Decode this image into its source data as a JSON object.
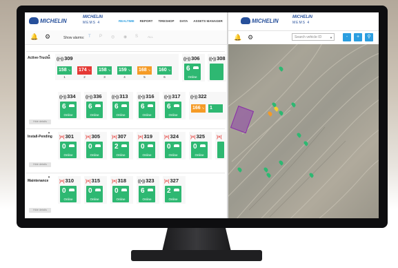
{
  "left_panel": {
    "brand_logo": "MICHELIN",
    "product_logo": {
      "line1": "MICHELIN",
      "line2": "MEMS 4"
    },
    "nav": [
      "REALTIME",
      "REPORT",
      "TIRESHOP",
      "DATA",
      "ASSETS MANAGER"
    ],
    "active_nav": "REALTIME",
    "toolbar": {
      "show_alarms_label": "Show alarms:",
      "all_label": "ALL",
      "icons": [
        "bell-icon",
        "gear-icon",
        "temperature-icon",
        "pressure-icon",
        "tire-icon",
        "signal-icon",
        "s-icon"
      ]
    },
    "sections": [
      {
        "label": "Active-Trucks",
        "hide_label": "Hide details",
        "trucks": [
          {
            "id": "309",
            "mini": [
              {
                "value": "158",
                "unit": "°c",
                "pos": "1"
              },
              {
                "value": "174",
                "unit": "°c",
                "pos": "2"
              },
              {
                "value": "158",
                "unit": "°c",
                "pos": "3"
              },
              {
                "value": "159",
                "unit": "°c",
                "pos": "4"
              },
              {
                "value": "168",
                "unit": "°c",
                "pos": "5"
              },
              {
                "value": "160",
                "unit": "°c",
                "pos": "6"
              }
            ]
          },
          {
            "id": "306",
            "count": "6",
            "status": "Online"
          },
          {
            "id": "308"
          },
          {
            "id": "334",
            "count": "6",
            "status": "Online"
          },
          {
            "id": "336",
            "count": "6",
            "status": "Online"
          },
          {
            "id": "313",
            "count": "6",
            "status": "Online"
          },
          {
            "id": "316",
            "count": "6",
            "status": "Online"
          },
          {
            "id": "317",
            "count": "6",
            "status": "Online"
          },
          {
            "id": "322",
            "mini": [
              {
                "value": "166",
                "unit": "°c"
              },
              {
                "value": "1",
                "unit": ""
              }
            ]
          }
        ]
      },
      {
        "label": "Install-Pending",
        "hide_label": "Hide details",
        "trucks": [
          {
            "id": "301",
            "count": "0",
            "status": "Online"
          },
          {
            "id": "305",
            "count": "0",
            "status": "Online"
          },
          {
            "id": "307",
            "count": "2",
            "status": "Online"
          },
          {
            "id": "319",
            "count": "0",
            "status": "Online"
          },
          {
            "id": "324",
            "count": "0",
            "status": "Online"
          },
          {
            "id": "325",
            "count": "0",
            "status": "Online"
          }
        ]
      },
      {
        "label": "Maintenance",
        "hide_label": "Hide details",
        "trucks": [
          {
            "id": "310",
            "count": "0",
            "status": "Online"
          },
          {
            "id": "315",
            "count": "0",
            "status": "Online"
          },
          {
            "id": "318",
            "count": "0",
            "status": "Online"
          },
          {
            "id": "323",
            "count": "6",
            "status": "Online"
          },
          {
            "id": "327",
            "count": "2",
            "status": "Online"
          }
        ]
      }
    ]
  },
  "right_panel": {
    "brand_logo": "MICHELIN",
    "product_logo": {
      "line1": "MICHELIN",
      "line2": "MEMS 4"
    },
    "search_placeholder": "Search vehicle ID",
    "map_buttons": [
      "-",
      "+",
      "⚲"
    ]
  },
  "colors": {
    "green": "#2eb872",
    "red": "#e53935",
    "orange": "#f59b26",
    "brand_blue": "#27509b",
    "accent": "#2b9ee0"
  }
}
